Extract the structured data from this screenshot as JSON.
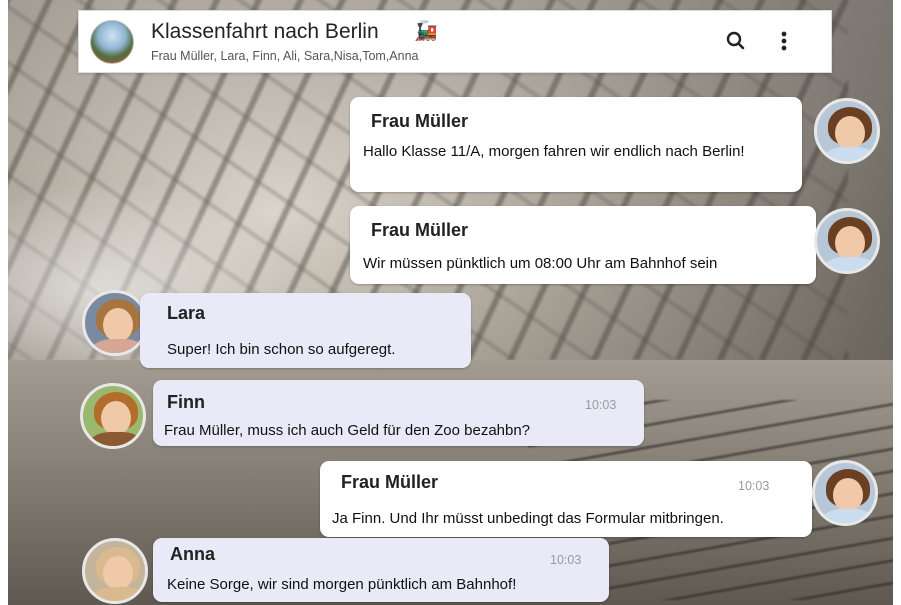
{
  "header": {
    "title": "Klassenfahrt nach Berlin",
    "title_icon": "train-icon",
    "participants": "Frau Müller, Lara, Finn, Ali, Sara,Nisa,Tom,Anna",
    "actions": [
      "search-icon",
      "more-vertical-icon"
    ]
  },
  "messages": [
    {
      "sender": "Frau Müller",
      "text": "Hallo Klasse 11/A, morgen fahren wir endlich nach Berlin!",
      "time": "",
      "direction": "outgoing"
    },
    {
      "sender": "Frau Müller",
      "text": "Wir müssen pünktlich um 08:00 Uhr am Bahnhof sein",
      "time": "",
      "direction": "outgoing"
    },
    {
      "sender": "Lara",
      "text": "Super! Ich bin schon so aufgeregt.",
      "time": "",
      "direction": "incoming"
    },
    {
      "sender": "Finn",
      "text": "Frau Müller, muss ich auch Geld für den Zoo bezahbn?",
      "time": "10:03",
      "direction": "incoming"
    },
    {
      "sender": "Frau Müller",
      "text": "Ja Finn. Und Ihr müsst unbedingt das Formular mitbringen.",
      "time": "10:03",
      "direction": "outgoing"
    },
    {
      "sender": "Anna",
      "text": "Keine Sorge, wir sind morgen pünktlich am Bahnhof!",
      "time": "10:03",
      "direction": "incoming"
    }
  ],
  "colors": {
    "outgoing_bubble": "#ffffff",
    "incoming_bubble": "#e9e9f8",
    "time_text": "#9a9a9a"
  }
}
